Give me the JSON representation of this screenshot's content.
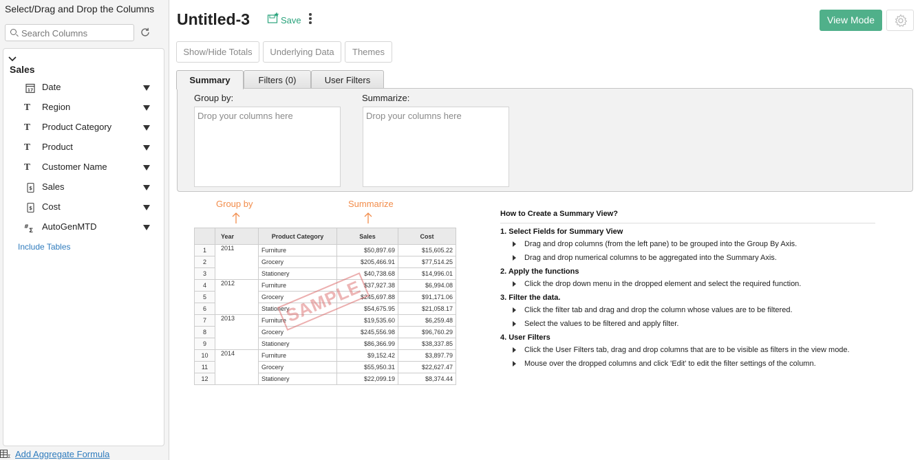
{
  "left_pane": {
    "title": "Select/Drag and Drop the Columns",
    "search_placeholder": "Search Columns",
    "table_name": "Sales",
    "columns": [
      {
        "label": "Date",
        "icon": "calendar-icon"
      },
      {
        "label": "Region",
        "icon": "text-type-icon"
      },
      {
        "label": "Product Category",
        "icon": "text-type-icon"
      },
      {
        "label": "Product",
        "icon": "text-type-icon"
      },
      {
        "label": "Customer Name",
        "icon": "text-type-icon"
      },
      {
        "label": "Sales",
        "icon": "currency-icon"
      },
      {
        "label": "Cost",
        "icon": "currency-icon"
      },
      {
        "label": "AutoGenMTD",
        "icon": "formula-icon"
      }
    ],
    "include_tables": "Include Tables",
    "add_aggregate_formula": "Add Aggregate Formula"
  },
  "header": {
    "title": "Untitled-3",
    "save_label": "Save",
    "view_mode_label": "View Mode"
  },
  "toolbar": {
    "show_hide_totals": "Show/Hide Totals",
    "underlying_data": "Underlying Data",
    "themes": "Themes"
  },
  "tabs": {
    "summary": "Summary",
    "filters": "Filters  (0)",
    "user_filters": "User Filters"
  },
  "summary_panel": {
    "group_by_label": "Group by:",
    "summarize_label": "Summarize:",
    "drop_placeholder": "Drop your columns here"
  },
  "sample": {
    "group_by_label": "Group by",
    "summarize_label": "Summarize",
    "stamp": "SAMPLE",
    "headers": [
      "",
      "Year",
      "Product Category",
      "Sales",
      "Cost"
    ],
    "rows": [
      [
        "1",
        "2011",
        "Furniture",
        "$50,897.69",
        "$15,605.22"
      ],
      [
        "2",
        "",
        "Grocery",
        "$205,466.91",
        "$77,514.25"
      ],
      [
        "3",
        "",
        "Stationery",
        "$40,738.68",
        "$14,996.01"
      ],
      [
        "4",
        "2012",
        "Furniture",
        "$37,927.38",
        "$6,994.08"
      ],
      [
        "5",
        "",
        "Grocery",
        "$245,697.88",
        "$91,171.06"
      ],
      [
        "6",
        "",
        "Stationery",
        "$54,675.95",
        "$21,058.17"
      ],
      [
        "7",
        "2013",
        "Furniture",
        "$19,535.60",
        "$6,259.48"
      ],
      [
        "8",
        "",
        "Grocery",
        "$245,556.98",
        "$96,760.29"
      ],
      [
        "9",
        "",
        "Stationery",
        "$86,366.99",
        "$38,337.85"
      ],
      [
        "10",
        "2014",
        "Furniture",
        "$9,152.42",
        "$3,897.79"
      ],
      [
        "11",
        "",
        "Grocery",
        "$55,950.31",
        "$22,627.47"
      ],
      [
        "12",
        "",
        "Stationery",
        "$22,099.19",
        "$8,374.44"
      ]
    ]
  },
  "howto": {
    "heading": "How to Create a Summary View?",
    "steps": [
      {
        "title": "1. Select Fields for Summary View",
        "bullets": [
          "Drag and drop columns (from the left pane) to be grouped into the Group By Axis.",
          "Drag and drop numerical columns to be aggregated into the Summary Axis."
        ]
      },
      {
        "title": "2. Apply the functions",
        "bullets": [
          "Click the drop down menu in the dropped element and select the required function."
        ]
      },
      {
        "title": "3. Filter the data.",
        "bullets": [
          "Click the filter tab and drag and drop the column whose values are to be filtered.",
          "Select the values to be filtered and apply filter."
        ]
      },
      {
        "title": "4. User Filters",
        "bullets": [
          "Click the User Filters tab, drag and drop columns that are to be visible as filters in the view mode.",
          "Mouse over the dropped columns and click 'Edit' to edit the filter settings of the column."
        ]
      }
    ]
  },
  "colors": {
    "accent": "#50b08a",
    "link": "#2e7bbd",
    "sample_label": "#f28c4a"
  }
}
